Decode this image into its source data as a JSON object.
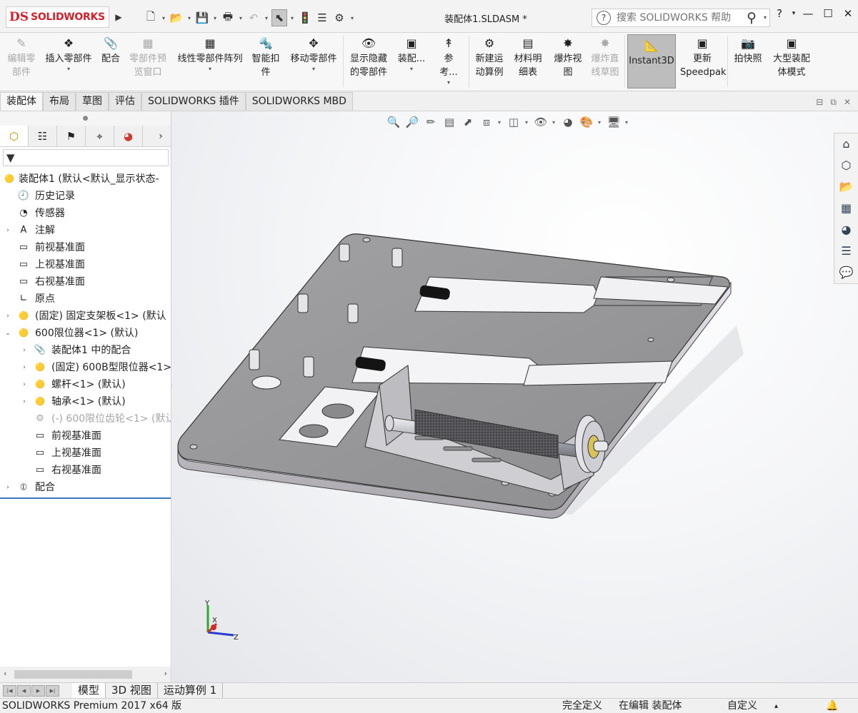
{
  "titlebar": {
    "logo_ds": "DS",
    "logo_text": "SOLIDWORKS",
    "expander": "▶",
    "document_title": "装配体1.SLDASM *",
    "help_placeholder": "搜索 SOLIDWORKS 帮助",
    "help_qmark": "?",
    "search_icon": "⚲",
    "help_button": "?",
    "help_dropdown": "▾",
    "minimize": "—",
    "maximize": "☐",
    "close": "✕",
    "qat": {
      "new": "🗋",
      "open": "📂",
      "save": "💾",
      "print": "🖶",
      "undo": "↶",
      "select": "⬉",
      "rebuild": "🚦",
      "file_props": "☰",
      "options": "⚙",
      "dropdown": "▾"
    }
  },
  "command_manager": {
    "tools": [
      {
        "id": "edit-component",
        "label": "编辑零\n部件",
        "disabled": true,
        "icon": "✎"
      },
      {
        "id": "insert-components",
        "label": "插入零部件",
        "disabled": false,
        "icon": "❖",
        "arrow": "▾"
      },
      {
        "id": "mate",
        "label": "配合",
        "disabled": false,
        "icon": "📎"
      },
      {
        "id": "component-preview",
        "label": "零部件预\n览窗口",
        "disabled": true,
        "icon": "▦"
      },
      {
        "id": "linear-pattern",
        "label": "线性零部件阵列",
        "disabled": false,
        "icon": "▦",
        "arrow": "▾"
      },
      {
        "id": "smart-fasteners",
        "label": "智能扣\n件",
        "disabled": false,
        "icon": "🔩"
      },
      {
        "id": "move-component",
        "label": "移动零部件",
        "disabled": false,
        "icon": "✥",
        "arrow": "▾"
      },
      {
        "id": "show-hidden",
        "label": "显示隐藏\n的零部件",
        "disabled": false,
        "icon": "👁"
      },
      {
        "id": "assembly-features",
        "label": "装配...",
        "disabled": false,
        "icon": "▣",
        "arrow": "▾"
      },
      {
        "id": "reference",
        "label": "参考...",
        "disabled": false,
        "icon": "↟",
        "arrow": "▾"
      },
      {
        "id": "new-motion-study",
        "label": "新建运\n动算例",
        "disabled": false,
        "icon": "⚙"
      },
      {
        "id": "bom",
        "label": "材料明\n细表",
        "disabled": false,
        "icon": "▤"
      },
      {
        "id": "exploded-view",
        "label": "爆炸视\n图",
        "disabled": false,
        "icon": "✸"
      },
      {
        "id": "explode-line",
        "label": "爆炸直\n线草图",
        "disabled": true,
        "icon": "✸"
      },
      {
        "id": "instant3d",
        "label": "Instant3D",
        "disabled": false,
        "icon": "📐",
        "active": true
      },
      {
        "id": "update-speedpak",
        "label": "更新\nSpeedpak",
        "disabled": false,
        "icon": "▣"
      },
      {
        "id": "snapshot",
        "label": "拍快照",
        "disabled": false,
        "icon": "📷"
      },
      {
        "id": "large-assembly",
        "label": "大型装配\n体模式",
        "disabled": false,
        "icon": "▣"
      }
    ]
  },
  "tabs": [
    "装配体",
    "布局",
    "草图",
    "评估",
    "SOLIDWORKS 插件",
    "SOLIDWORKS MBD"
  ],
  "viewport_controls": [
    "⊟",
    "⧉",
    "✕"
  ],
  "panel": {
    "collapse_handle": "●",
    "tab_icons": [
      "⬡",
      "☷",
      "⚑",
      "⌖",
      "◕"
    ],
    "more": "›",
    "filter_icon": "▼"
  },
  "tree": [
    {
      "depth": 0,
      "twisty": "",
      "icon": "🟡",
      "label": "装配体1  (默认<默认_显示状态-",
      "dim": false
    },
    {
      "depth": 1,
      "twisty": "",
      "icon": "🕘",
      "label": "历史记录",
      "dim": false
    },
    {
      "depth": 1,
      "twisty": "",
      "icon": "◔",
      "label": "传感器",
      "dim": false
    },
    {
      "depth": 1,
      "twisty": "›",
      "icon": "A",
      "label": "注解",
      "dim": false
    },
    {
      "depth": 1,
      "twisty": "",
      "icon": "▭",
      "label": "前视基准面",
      "dim": false
    },
    {
      "depth": 1,
      "twisty": "",
      "icon": "▭",
      "label": "上视基准面",
      "dim": false
    },
    {
      "depth": 1,
      "twisty": "",
      "icon": "▭",
      "label": "右视基准面",
      "dim": false
    },
    {
      "depth": 1,
      "twisty": "",
      "icon": "∟",
      "label": "原点",
      "dim": false
    },
    {
      "depth": 1,
      "twisty": "›",
      "icon": "🟡",
      "label": "(固定) 固定支架板<1> (默认",
      "dim": false
    },
    {
      "depth": 1,
      "twisty": "⌄",
      "icon": "🟡",
      "label": "600限位器<1> (默认)",
      "dim": false
    },
    {
      "depth": 2,
      "twisty": "›",
      "icon": "📎",
      "label": "装配体1 中的配合",
      "dim": false
    },
    {
      "depth": 2,
      "twisty": "›",
      "icon": "🟡",
      "label": "(固定) 600B型限位器<1>",
      "dim": false
    },
    {
      "depth": 2,
      "twisty": "›",
      "icon": "🟡",
      "label": "螺杆<1> (默认)",
      "dim": false
    },
    {
      "depth": 2,
      "twisty": "›",
      "icon": "🟡",
      "label": "轴承<1> (默认)",
      "dim": false
    },
    {
      "depth": 2,
      "twisty": "",
      "icon": "⚙",
      "label": "(-) 600限位齿轮<1> (默认",
      "dim": true
    },
    {
      "depth": 2,
      "twisty": "",
      "icon": "▭",
      "label": "前视基准面",
      "dim": false
    },
    {
      "depth": 2,
      "twisty": "",
      "icon": "▭",
      "label": "上视基准面",
      "dim": false
    },
    {
      "depth": 2,
      "twisty": "",
      "icon": "▭",
      "label": "右视基准面",
      "dim": false
    },
    {
      "depth": 1,
      "twisty": "›",
      "icon": "⦶",
      "label": "配合",
      "dim": false
    }
  ],
  "hscroll": {
    "left": "‹",
    "right": "›"
  },
  "hud_icons": [
    "🔍",
    "🔎",
    "✏",
    "▤",
    "⬈",
    "⧈",
    "◫",
    "👁",
    "◕",
    "🎨",
    "🖥"
  ],
  "taskpane_icons": [
    "⌂",
    "⬡",
    "📂",
    "▦",
    "◕",
    "☰",
    "💬"
  ],
  "triad": {
    "x": "X",
    "y": "Y",
    "z": "Z"
  },
  "bottom_tabs": [
    "模型",
    "3D 视图",
    "运动算例 1"
  ],
  "nav_arrows": [
    "|◀",
    "◀",
    "▶",
    "▶|"
  ],
  "status": {
    "product": "SOLIDWORKS Premium 2017 x64 版",
    "fully_defined": "完全定义",
    "editing": "在编辑 装配体",
    "units": "自定义",
    "units_arrow": "▴",
    "rebuild_icon": "🔔"
  },
  "colors": {
    "accent": "#d4202a",
    "plate": "#8f8f91",
    "plate_top": "#9a9a9c",
    "bg": "#f0f0f0"
  }
}
